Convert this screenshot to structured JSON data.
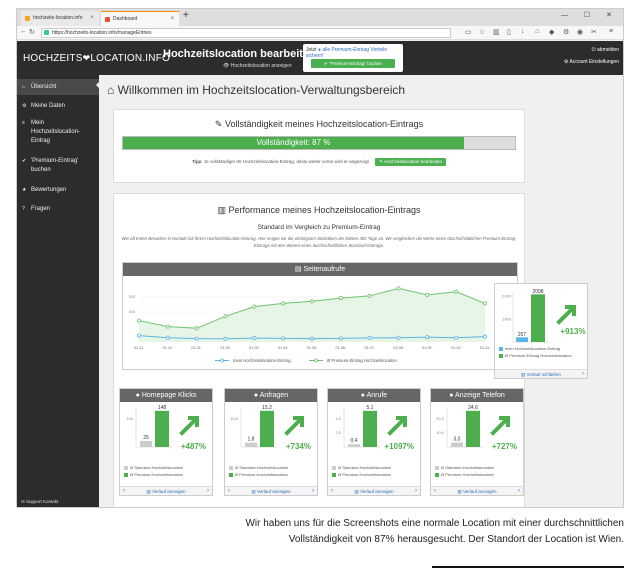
{
  "browser": {
    "tabs": [
      {
        "label": "hochzeits-location.info",
        "close": "×"
      },
      {
        "label": "Dashboard",
        "close": "×"
      }
    ],
    "new_tab": "+",
    "url": "https://hochzeits-location.info/manageEntries",
    "window_controls": "— ☐ ✕"
  },
  "header": {
    "logo_left": "HOCHZEITS",
    "logo_right": "LOCATION.INFO",
    "title": "Hochzeitslocation bearbeiten",
    "show_link": "Hochzeitslocation anzeigen",
    "premium_now": "Jetzt",
    "premium_link": "alle Premium-Eintrag Vorteile sichern!",
    "premium_button": "Premium-Eintrag\" buchen",
    "logout": "abmelden",
    "account": "Account Einstellungen"
  },
  "sidebar": {
    "items": [
      {
        "label": "Übersicht"
      },
      {
        "label": "Meine Daten"
      },
      {
        "label": "Mein Hochzeitslocation-Eintrag"
      },
      {
        "label": "'Premium-Eintrag' buchen"
      },
      {
        "label": "Bewertungen"
      },
      {
        "label": "Fragen"
      }
    ],
    "support": "Support Kontakt"
  },
  "main": {
    "welcome": "Willkommen im Hochzeitslocation-Verwaltungsbereich",
    "completeness": {
      "title": "Vollständigkeit meines Hochzeitslocation-Eintrags",
      "bar_label": "Vollständigkeit: 87 %",
      "value": 87,
      "tip_bold": "Tipp",
      "tip": ": Je vollständiger Ihr Hochzeitslocation-Eintrag, desto weiter vorne wird er angezeigt.",
      "edit_button": "Hochzeitslocation bearbeiten"
    },
    "performance": {
      "title": "Performance meines Hochzeitslocation-Eintrags",
      "subtitle": "Standard im Vergleich zu Premium-Eintrag",
      "desc1": "Wie oft treten Besucher in Kontakt mit Ihrem Hochzeitslocation-Eintrag. Hier zeigen wir die wichtigsten Statistiken der letzten 365 Tage an. Wir vergleichen die Werte eines durchschnittlichen Premium-Eintrag-",
      "desc2": "Eintrags mit den Werten eines durchschnittlichen Standard-Eintrags."
    },
    "pageviews": {
      "title": "Seitenaufrufe",
      "legend_mine": "mein Hochzeitslocation-Eintrag",
      "legend_premium": "Ø Premium-Eintrag Hochzeitslocation",
      "bar_legend_mine": "mein Hochzeitslocation-Eintrag",
      "bar_legend_premium": "Ø Premium-Eintrag Hochzeitslocation",
      "percent": "+913%",
      "history_link": "Verlauf schließen"
    },
    "kpis": [
      {
        "title": "Homepage Klicks",
        "std": "25",
        "prem": "148",
        "ytop": "100",
        "percent": "+487%",
        "link": "Verlauf anzeigen"
      },
      {
        "title": "Anfragen",
        "std": "1,8",
        "prem": "15,2",
        "ytop": "10,0",
        "percent": "+734%",
        "link": "Verlauf anzeigen"
      },
      {
        "title": "Anrufe",
        "std": "0,4",
        "prem": "5,1",
        "ytop": "4,0",
        "ymid": "2,0",
        "percent": "+1097%",
        "link": "Verlauf anzeigen"
      },
      {
        "title": "Anzeige Telefon",
        "std": "3,0",
        "prem": "24,6",
        "ytop": "20,0",
        "ymid": "10,0",
        "percent": "+727%",
        "link": "Verlauf anzeigen"
      }
    ],
    "kpi_legend_std": "Ø Standard-Hochzeitslocation",
    "kpi_legend_prem": "Ø Premium-Hochzeitslocation"
  },
  "caption": {
    "line1": "Wir haben uns für die Screenshots eine normale Location mit einer durchschnittlichen",
    "line2": "Vollständigkeit von 87% herausgesucht. Der Standort der Location ist Wien."
  },
  "colors": {
    "green": "#4cae4c",
    "blue": "#5bb5e6",
    "dark": "#2c2c2c",
    "header_gray": "#666666"
  },
  "chart_data": [
    {
      "type": "line",
      "title": "Seitenaufrufe",
      "x": [
        "01.11.",
        "01.12.",
        "01.01.",
        "01.02.",
        "01.03.",
        "01.04.",
        "01.05.",
        "01.06.",
        "01.07.",
        "01.08.",
        "01.09.",
        "01.10.",
        "01.11."
      ],
      "ylim": [
        0,
        2800
      ],
      "yticks": [
        "200",
        "100"
      ],
      "series": [
        {
          "name": "mein Hochzeitslocation-Eintrag",
          "color": "#5bb5e6",
          "values": [
            300,
            200,
            160,
            150,
            180,
            170,
            160,
            170,
            190,
            200,
            230,
            200,
            250
          ]
        },
        {
          "name": "Ø Premium-Eintrag Hochzeitslocation",
          "color": "#6fc36f",
          "values": [
            1000,
            720,
            640,
            1200,
            1650,
            1800,
            1900,
            2050,
            2150,
            2500,
            2200,
            2350,
            1800
          ]
        }
      ]
    },
    {
      "type": "bar",
      "categories": [
        "mein Hochzeitslocation-Eintrag",
        "Ø Premium-Eintrag Hochzeitslocation"
      ],
      "values": [
        207,
        2098
      ],
      "yticks": [
        "2000",
        "1000"
      ],
      "ylim": [
        0,
        2200
      ]
    }
  ]
}
